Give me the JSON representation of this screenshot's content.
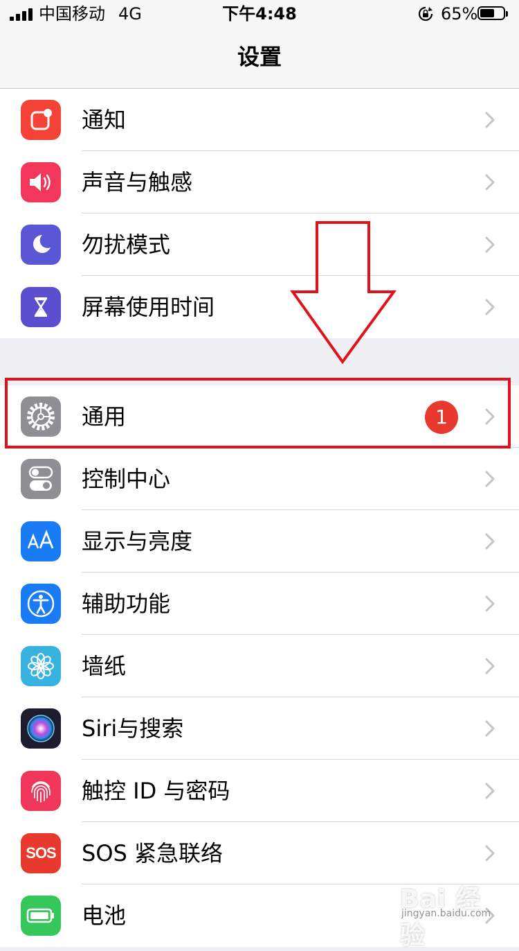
{
  "status_bar": {
    "carrier": "中国移动",
    "network": "4G",
    "time": "下午4:48",
    "battery_percent": "65%",
    "battery_level": 0.65
  },
  "nav": {
    "title": "设置"
  },
  "groups": [
    {
      "items": [
        {
          "label": "通知",
          "icon": "notifications-icon",
          "color": "#f44336"
        },
        {
          "label": "声音与触感",
          "icon": "sounds-icon",
          "color": "#f2375a"
        },
        {
          "label": "勿扰模式",
          "icon": "moon-icon",
          "color": "#5b56d6"
        },
        {
          "label": "屏幕使用时间",
          "icon": "hourglass-icon",
          "color": "#5b4fcf"
        }
      ]
    },
    {
      "items": [
        {
          "label": "通用",
          "icon": "gear-icon",
          "color": "#8e8e93",
          "badge": "1"
        },
        {
          "label": "控制中心",
          "icon": "toggles-icon",
          "color": "#8e8e93"
        },
        {
          "label": "显示与亮度",
          "icon": "text-size-icon",
          "color": "#1a7cf5"
        },
        {
          "label": "辅助功能",
          "icon": "accessibility-icon",
          "color": "#1a7cf5"
        },
        {
          "label": "墙纸",
          "icon": "flower-icon",
          "color": "#38b3e0"
        },
        {
          "label": "Siri与搜索",
          "icon": "siri-icon",
          "color": "#1c1c2e"
        },
        {
          "label": "触控 ID 与密码",
          "icon": "fingerprint-icon",
          "color": "#f0375b"
        },
        {
          "label": "SOS 紧急联络",
          "icon": "sos-icon",
          "color": "#e8392e",
          "icon_text": "SOS"
        },
        {
          "label": "电池",
          "icon": "battery-icon",
          "color": "#35c759"
        }
      ]
    }
  ],
  "annotation": {
    "color": "#e0121b"
  },
  "watermark": {
    "text": "Bai 经验",
    "sub": "jingyan.baidu.com"
  }
}
